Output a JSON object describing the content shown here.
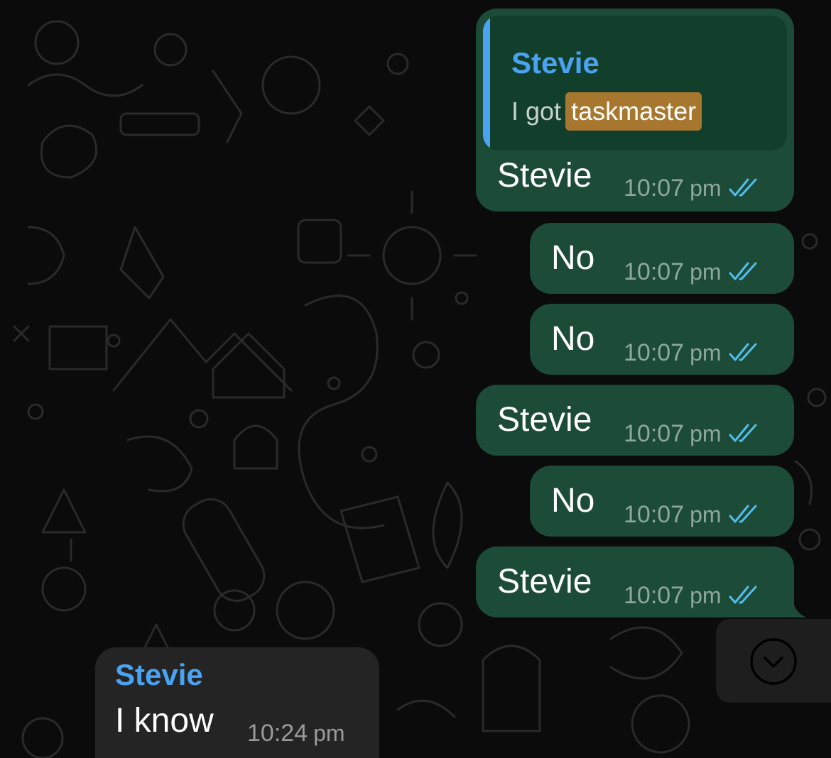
{
  "messages": [
    {
      "quote_sender": "Stevie",
      "quote_prefix": "I got",
      "quote_highlight": "taskmaster",
      "text": "Stevie",
      "time": "10:07",
      "ampm": "pm"
    },
    {
      "text": "No",
      "time": "10:07",
      "ampm": "pm"
    },
    {
      "text": "No",
      "time": "10:07",
      "ampm": "pm"
    },
    {
      "text": "Stevie",
      "time": "10:07",
      "ampm": "pm"
    },
    {
      "text": "No",
      "time": "10:07",
      "ampm": "pm"
    },
    {
      "text": "Stevie",
      "time": "10:07",
      "ampm": "pm"
    }
  ],
  "incoming": {
    "sender": "Stevie",
    "text": "I know",
    "time": "10:24",
    "ampm": "pm"
  },
  "icons": {
    "read_receipt": "double-check-icon",
    "scroll_down": "chevron-down-circle-icon"
  },
  "colors": {
    "outgoing_bubble": "#1c4b38",
    "incoming_bubble": "#242424",
    "sender_name": "#4aa3f0",
    "read_tick": "#53bdeb",
    "highlight": "#a8772f"
  }
}
